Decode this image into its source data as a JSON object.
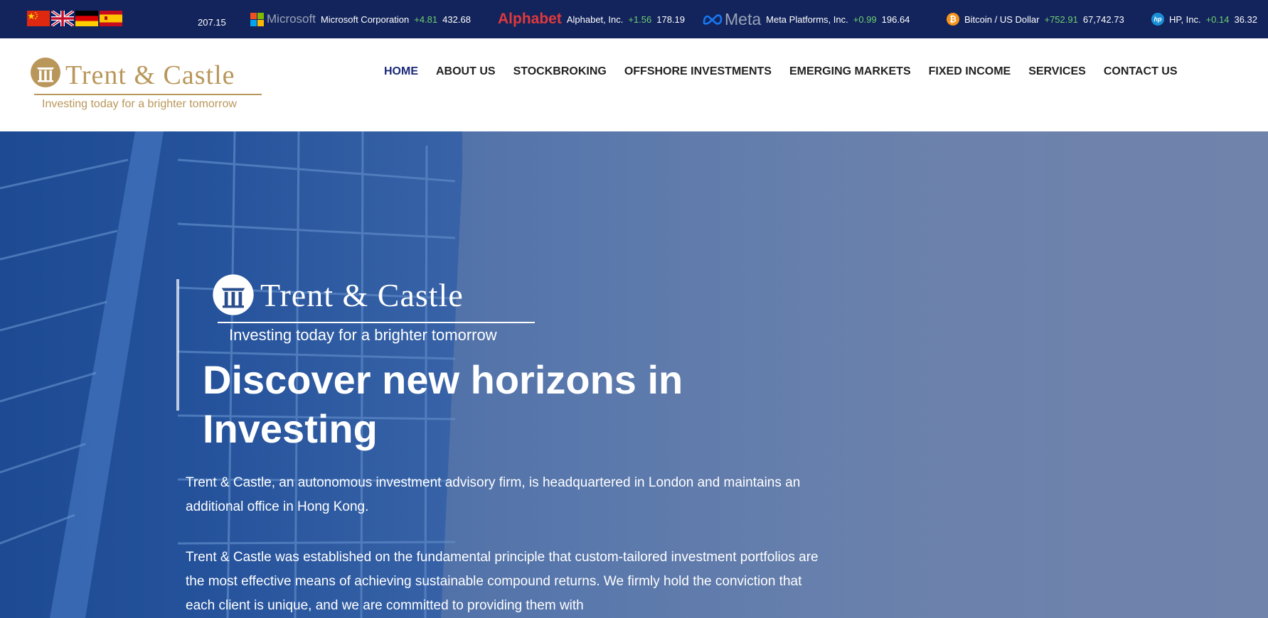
{
  "ticker": {
    "flags": [
      {
        "icon": "china-flag-icon",
        "color": "#de2910"
      },
      {
        "icon": "uk-flag-icon",
        "color": "#012169"
      },
      {
        "icon": "germany-flag-icon",
        "color": "#000000"
      },
      {
        "icon": "spain-flag-icon",
        "color": "#c60b1e"
      }
    ],
    "first_price": "207.15",
    "items": [
      {
        "brand": "Microsoft",
        "name": "Microsoft Corporation",
        "change": "+4.81",
        "price": "432.68"
      },
      {
        "brand": "Alphabet",
        "name": "Alphabet, Inc.",
        "change": "+1.56",
        "price": "178.19"
      },
      {
        "brand": "Meta",
        "name": "Meta Platforms, Inc.",
        "change": "+0.99",
        "price": "196.64"
      },
      {
        "brand": "bitcoin-icon",
        "name": "Bitcoin / US Dollar",
        "change": "+752.91",
        "price": "67,742.73"
      },
      {
        "brand": "hp-icon",
        "name": "HP, Inc.",
        "change": "+0.14",
        "price": "36.32"
      }
    ],
    "colors": {
      "bar": "#13245c",
      "positive": "#6fcf6f"
    }
  },
  "header": {
    "logo_title": "Trent & Castle",
    "logo_tagline": "Investing today for a brighter tomorrow",
    "brand_color": "#b9975b",
    "nav": [
      {
        "label": "HOME",
        "active": true
      },
      {
        "label": "ABOUT US"
      },
      {
        "label": "STOCKBROKING"
      },
      {
        "label": "OFFSHORE INVESTMENTS"
      },
      {
        "label": "EMERGING MARKETS"
      },
      {
        "label": "FIXED INCOME"
      },
      {
        "label": "SERVICES"
      },
      {
        "label": "CONTACT US"
      }
    ]
  },
  "hero": {
    "logo_title": "Trent & Castle",
    "logo_tagline": "Investing today for a brighter tomorrow",
    "heading": "Discover new horizons in Investing",
    "paragraph1": "Trent & Castle, an autonomous investment advisory firm, is headquartered in London and maintains an additional office in Hong Kong.",
    "paragraph2": "Trent & Castle was established on the fundamental principle that custom-tailored investment portfolios are the most effective means of achieving sustainable compound returns. We firmly hold the conviction that each client is unique, and we are committed to providing them with"
  }
}
